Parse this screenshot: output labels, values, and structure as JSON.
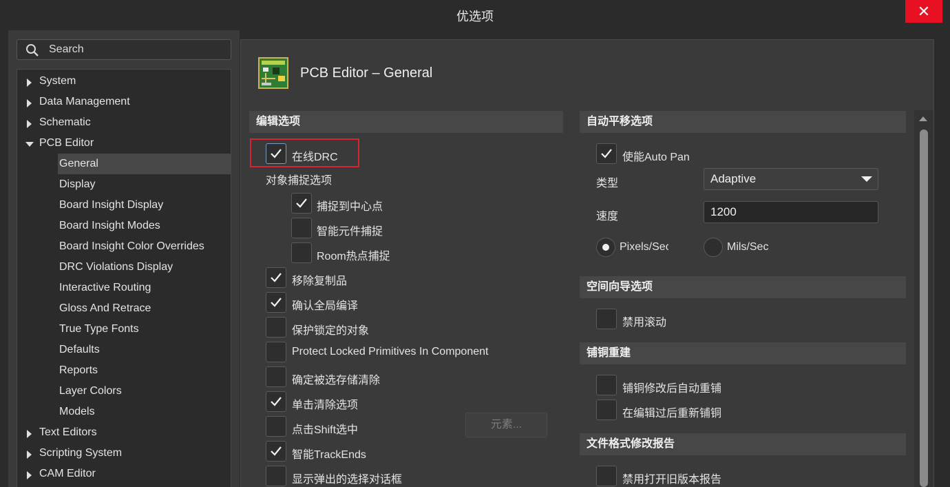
{
  "window": {
    "title": "优选项",
    "close_label": "✕"
  },
  "search": {
    "placeholder": "Search"
  },
  "tree": {
    "items": [
      {
        "label": "System",
        "expander": "collapsed"
      },
      {
        "label": "Data Management",
        "expander": "collapsed"
      },
      {
        "label": "Schematic",
        "expander": "collapsed"
      },
      {
        "label": "PCB Editor",
        "expander": "expanded"
      },
      {
        "label": "General",
        "selected": true
      },
      {
        "label": "Display"
      },
      {
        "label": "Board Insight Display"
      },
      {
        "label": "Board Insight Modes"
      },
      {
        "label": "Board Insight Color Overrides"
      },
      {
        "label": "DRC Violations Display"
      },
      {
        "label": "Interactive Routing"
      },
      {
        "label": "Gloss And Retrace"
      },
      {
        "label": "True Type Fonts"
      },
      {
        "label": "Defaults"
      },
      {
        "label": "Reports"
      },
      {
        "label": "Layer Colors"
      },
      {
        "label": "Models"
      },
      {
        "label": "Text Editors",
        "expander": "collapsed"
      },
      {
        "label": "Scripting System",
        "expander": "collapsed"
      },
      {
        "label": "CAM Editor",
        "expander": "collapsed"
      }
    ]
  },
  "page": {
    "title": "PCB Editor – General",
    "icon": "pcb-board-icon"
  },
  "editing": {
    "heading": "编辑选项",
    "online_drc": {
      "label": "在线DRC",
      "checked": true
    },
    "snap_group_label": "对象捕捉选项",
    "snap_center": {
      "label": "捕捉到中心点",
      "checked": true
    },
    "smart_component_snap": {
      "label": "智能元件捕捉",
      "checked": false
    },
    "room_hotspot_snap": {
      "label": "Room热点捕捉",
      "checked": false
    },
    "remove_duplicates": {
      "label": "移除复制品",
      "checked": true
    },
    "confirm_global_edit": {
      "label": "确认全局编译",
      "checked": true
    },
    "protect_locked": {
      "label": "保护锁定的对象",
      "checked": false
    },
    "protect_locked_primitives": {
      "label": "Protect Locked Primitives In Component",
      "checked": false
    },
    "confirm_selection_memory_clear": {
      "label": "确定被选存储清除",
      "checked": false
    },
    "click_clears_selection": {
      "label": "单击清除选项",
      "checked": true
    },
    "shift_click_select": {
      "label": "点击Shift选中",
      "checked": false
    },
    "primitives_button": "元素...",
    "smart_track_ends": {
      "label": "智能TrackEnds",
      "checked": true
    },
    "show_popup_selection": {
      "label": "显示弹出的选择对话框",
      "checked": false
    }
  },
  "autopan": {
    "heading": "自动平移选项",
    "enable": {
      "label": "使能Auto Pan",
      "checked": true
    },
    "type_label": "类型",
    "type_value": "Adaptive",
    "speed_label": "速度",
    "speed_value": "1200",
    "unit_pixels": {
      "label": "Pixels/Sec",
      "selected": true
    },
    "unit_mils": {
      "label": "Mils/Sec",
      "selected": false
    }
  },
  "space_navigator": {
    "heading": "空间向导选项",
    "disable_roll": {
      "label": "禁用滚动",
      "checked": false
    }
  },
  "polygon_rebuild": {
    "heading": "铺铜重建",
    "auto_rebuild": {
      "label": "铺铜修改后自动重铺",
      "checked": false
    },
    "repour_after_edit": {
      "label": "在编辑过后重新铺铜",
      "checked": false
    }
  },
  "file_format_report": {
    "heading": "文件格式修改报告",
    "disable_old_version": {
      "label": "禁用打开旧版本报告",
      "checked": false
    }
  },
  "colors": {
    "accent_highlight": "#d9232e",
    "close_button": "#e81123"
  }
}
